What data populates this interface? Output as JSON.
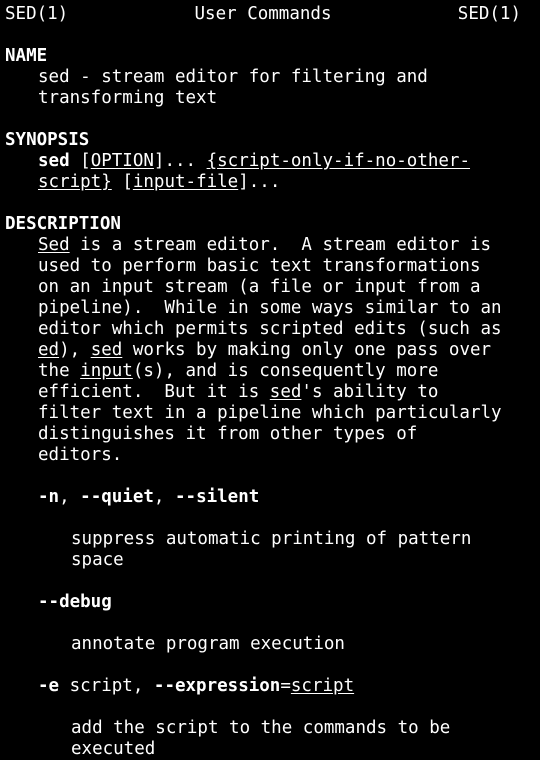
{
  "header": {
    "left": "SED(1)",
    "center": "User Commands",
    "right": "SED(1)"
  },
  "name_section": {
    "heading": "NAME",
    "lines": [
      "sed - stream editor for filtering and",
      "transforming text"
    ]
  },
  "synopsis": {
    "heading": "SYNOPSIS",
    "l1_cmd": "sed",
    "l1_open": "[",
    "l1_option": "OPTION",
    "l1_close": "]... ",
    "l1_script": "{script-only-if-no-other-",
    "l2_script": "script}",
    "l2_sp": " ",
    "l2_open": "[",
    "l2_input": "input-file",
    "l2_close": "]..."
  },
  "description": {
    "heading": "DESCRIPTION",
    "l1_sed": "Sed",
    "l1_rest": " is a stream editor.  A stream editor is",
    "l2": "used to perform basic text transformations",
    "l3": "on an input stream (a file or input from a",
    "l4": "pipeline).  While in some ways similar to an",
    "l5": "editor which permits scripted edits (such as",
    "l6_ed": "ed",
    "l6_mid": "), ",
    "l6_sed": "sed",
    "l6_rest": " works by making only one pass over",
    "l7_pre": "the ",
    "l7_input": "input",
    "l7_rest": "(s), and is consequently more",
    "l8_pre": "efficient.  But it is ",
    "l8_sed": "sed",
    "l8_rest": "'s ability to",
    "l9": "filter text in a pipeline which particularly",
    "l10": "distinguishes it from other types of",
    "l11": "editors."
  },
  "options": {
    "quiet": {
      "flag_n": "-n",
      "sep1": ", ",
      "flag_quiet": "--quiet",
      "sep2": ", ",
      "flag_silent": "--silent",
      "desc1": "suppress automatic printing of pattern",
      "desc2": "space"
    },
    "debug": {
      "flag": "--debug",
      "desc": "annotate program execution"
    },
    "expression": {
      "flag_e": "-e",
      "arg1": " script, ",
      "flag_expr": "--expression",
      "eq": "=",
      "arg2": "script",
      "desc1": "add the script to the commands to be",
      "desc2": "executed"
    }
  }
}
